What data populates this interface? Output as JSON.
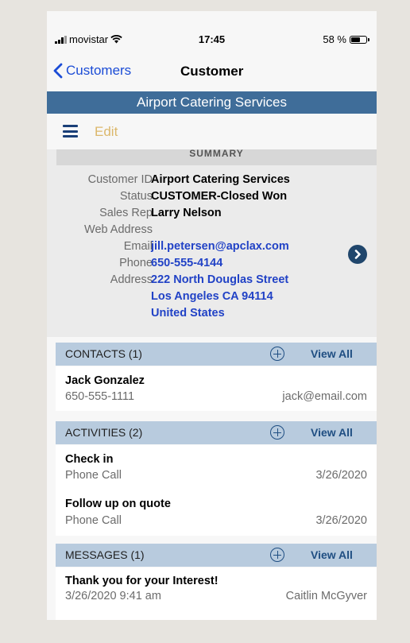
{
  "status_bar": {
    "carrier": "movistar",
    "time": "17:45",
    "battery": "58 %"
  },
  "nav": {
    "back_label": "Customers",
    "title": "Customer"
  },
  "customer_banner": "Airport Catering Services",
  "toolbar": {
    "edit_label": "Edit"
  },
  "summary": {
    "header": "SUMMARY",
    "fields": [
      {
        "label": "Customer ID",
        "value": "Airport Catering Services"
      },
      {
        "label": "Status",
        "value": "CUSTOMER-Closed Won"
      },
      {
        "label": "Sales Rep",
        "value": "Larry Nelson"
      },
      {
        "label": "Web Address",
        "value": ""
      },
      {
        "label": "Email",
        "value": "jill.petersen@apclax.com"
      },
      {
        "label": "Phone",
        "value": "650-555-4144"
      },
      {
        "label": "Address",
        "lines": [
          "222 North Douglas Street",
          "Los Angeles CA 94114",
          "United States"
        ]
      }
    ]
  },
  "contacts": {
    "header": "CONTACTS (1)",
    "view_all": "View All",
    "items": [
      {
        "name": "Jack Gonzalez",
        "phone": "650-555-1111",
        "email": "jack@email.com"
      }
    ]
  },
  "activities": {
    "header": "ACTIVITIES (2)",
    "view_all": "View All",
    "items": [
      {
        "title": "Check in",
        "type": "Phone Call",
        "date": "3/26/2020"
      },
      {
        "title": "Follow up on quote",
        "type": "Phone Call",
        "date": "3/26/2020"
      }
    ]
  },
  "messages": {
    "header": "MESSAGES (1)",
    "view_all": "View All",
    "items": [
      {
        "subject": "Thank you for your Interest!",
        "datetime": "3/26/2020 9:41 am",
        "from": "Caitlin McGyver"
      }
    ]
  },
  "colors": {
    "link": "#2142c6",
    "banner": "#3f6d99",
    "section_header": "#b8cbde",
    "edit": "#dcb86c",
    "background": "#e7e4df"
  }
}
